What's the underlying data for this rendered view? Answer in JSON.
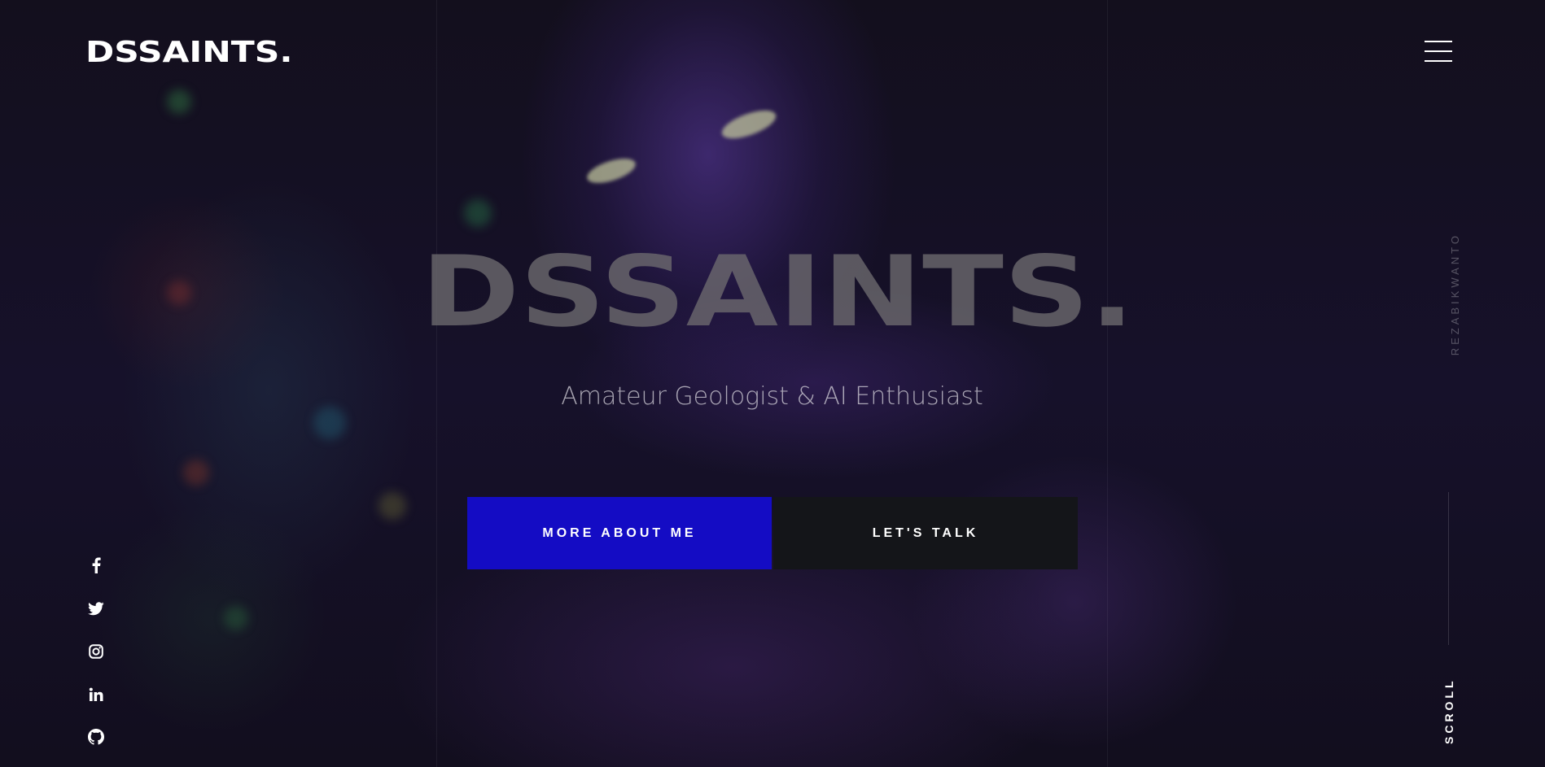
{
  "header": {
    "logo": "DSSAINTS.",
    "menu_icon": "hamburger-menu-icon"
  },
  "hero": {
    "title": "DSSAINTS.",
    "subtitle": "Amateur Geologist & AI Enthusiast",
    "primary_button": "MORE ABOUT ME",
    "secondary_button": "LET'S TALK"
  },
  "sidebar": {
    "vertical_name": "REZABIKWANTO",
    "scroll_label": "SCROLL"
  },
  "social": [
    {
      "icon": "facebook-icon"
    },
    {
      "icon": "twitter-icon"
    },
    {
      "icon": "instagram-icon"
    },
    {
      "icon": "linkedin-icon"
    },
    {
      "icon": "github-icon"
    }
  ],
  "colors": {
    "background": "#120f1c",
    "primary_button": "#140cc4",
    "secondary_button": "#141519",
    "hero_title": "#6e6c70"
  }
}
